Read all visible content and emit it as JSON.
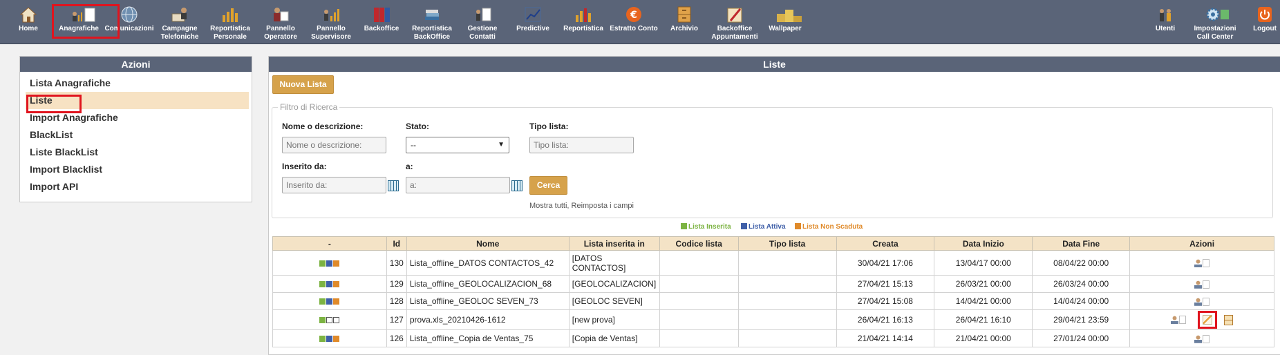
{
  "toolbar": {
    "items": [
      {
        "label": "Home"
      },
      {
        "label": "Anagrafiche"
      },
      {
        "label": "Comunicazioni"
      },
      {
        "label": "Campagne Telefoniche"
      },
      {
        "label": "Reportistica Personale"
      },
      {
        "label": "Pannello Operatore"
      },
      {
        "label": "Pannello Supervisore"
      },
      {
        "label": "Backoffice"
      },
      {
        "label": "Reportistica BackOffice"
      },
      {
        "label": "Gestione Contatti"
      },
      {
        "label": "Predictive"
      },
      {
        "label": "Reportistica"
      },
      {
        "label": "Estratto Conto"
      },
      {
        "label": "Archivio"
      },
      {
        "label": "Backoffice Appuntamenti"
      },
      {
        "label": "Wallpaper"
      },
      {
        "label": "Utenti"
      },
      {
        "label": "Impostazioni Call Center"
      },
      {
        "label": "Logout"
      }
    ]
  },
  "actions_panel": {
    "title": "Azioni",
    "items": [
      {
        "label": "Lista Anagrafiche"
      },
      {
        "label": "Liste"
      },
      {
        "label": "Import Anagrafiche"
      },
      {
        "label": "BlackList"
      },
      {
        "label": "Liste BlackList"
      },
      {
        "label": "Import Blacklist"
      },
      {
        "label": "Import API"
      }
    ]
  },
  "lists_panel": {
    "title": "Liste",
    "new_button": "Nuova Lista",
    "filter": {
      "legend": "Filtro di Ricerca",
      "name_label": "Nome o descrizione:",
      "name_placeholder": "Nome o descrizione:",
      "state_label": "Stato:",
      "state_value": "--",
      "type_label": "Tipo lista:",
      "type_placeholder": "Tipo lista:",
      "from_label": "Inserito da:",
      "from_placeholder": "Inserito da:",
      "to_label": "a:",
      "to_placeholder": "a:",
      "search_button": "Cerca",
      "links": "Mostra tutti, Reimposta i campi"
    },
    "legend": [
      {
        "label": "Lista Inserita",
        "color": "#7cb342"
      },
      {
        "label": "Lista Attiva",
        "color": "#3f5fa8"
      },
      {
        "label": "Lista Non Scaduta",
        "color": "#e08a2a"
      }
    ],
    "table": {
      "headers": [
        "-",
        "Id",
        "Nome",
        "Lista inserita in",
        "Codice lista",
        "Tipo lista",
        "Creata",
        "Data Inizio",
        "Data Fine",
        "Azioni"
      ],
      "rows": [
        {
          "id": "130",
          "nome": "Lista_offline_DATOS CONTACTOS_42",
          "inserita": "[DATOS CONTACTOS]",
          "codice": "",
          "tipo": "",
          "creata": "30/04/21 17:06",
          "inizio": "13/04/17 00:00",
          "fine": "08/04/22 00:00"
        },
        {
          "id": "129",
          "nome": "Lista_offline_GEOLOCALIZACION_68",
          "inserita": "[GEOLOCALIZACION]",
          "codice": "",
          "tipo": "",
          "creata": "27/04/21 15:13",
          "inizio": "26/03/21 00:00",
          "fine": "26/03/24 00:00"
        },
        {
          "id": "128",
          "nome": "Lista_offline_GEOLOC SEVEN_73",
          "inserita": "[GEOLOC SEVEN]",
          "codice": "",
          "tipo": "",
          "creata": "27/04/21 15:08",
          "inizio": "14/04/21 00:00",
          "fine": "14/04/24 00:00"
        },
        {
          "id": "127",
          "nome": "prova.xls_20210426-1612",
          "inserita": "[new prova]",
          "codice": "",
          "tipo": "",
          "creata": "26/04/21 16:13",
          "inizio": "26/04/21 16:10",
          "fine": "29/04/21 23:59"
        },
        {
          "id": "126",
          "nome": "Lista_offline_Copia de Ventas_75",
          "inserita": "[Copia de Ventas]",
          "codice": "",
          "tipo": "",
          "creata": "21/04/21 14:14",
          "inizio": "21/04/21 00:00",
          "fine": "27/01/24 00:00"
        }
      ]
    }
  }
}
